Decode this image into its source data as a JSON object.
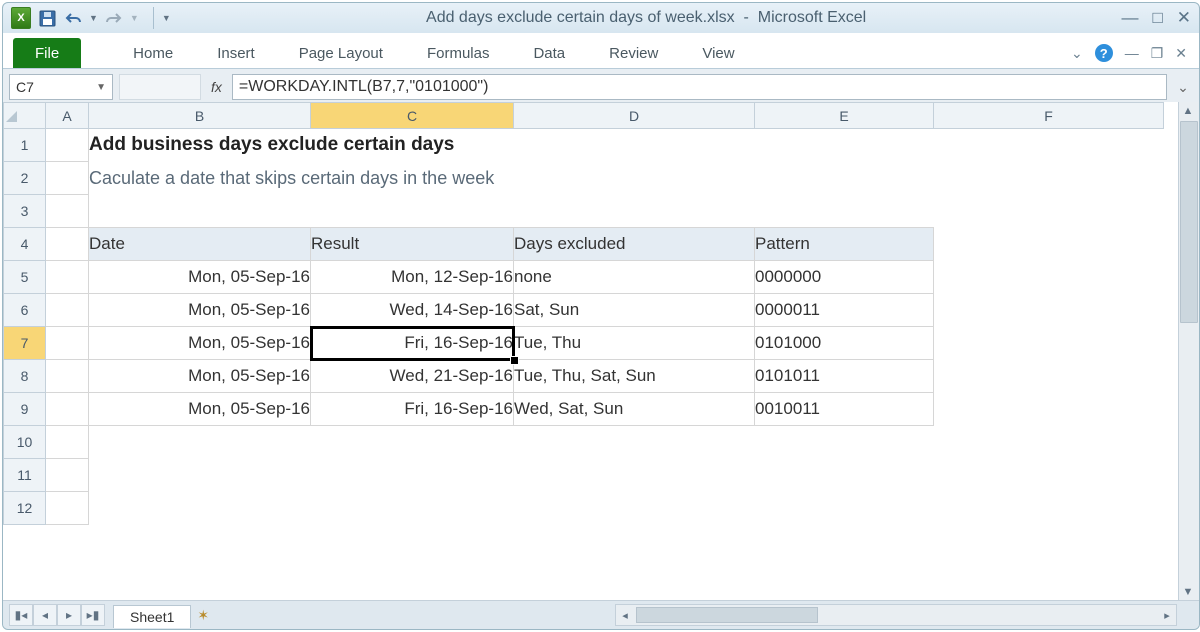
{
  "titlebar": {
    "doc": "Add days exclude certain days of week.xlsx",
    "app": "Microsoft Excel"
  },
  "ribbon": {
    "file": "File",
    "tabs": [
      "Home",
      "Insert",
      "Page Layout",
      "Formulas",
      "Data",
      "Review",
      "View"
    ]
  },
  "formula_bar": {
    "name_box": "C7",
    "fx": "fx",
    "formula": "=WORKDAY.INTL(B7,7,\"0101000\")"
  },
  "columns": [
    "A",
    "B",
    "C",
    "D",
    "E",
    "F"
  ],
  "rows": [
    "1",
    "2",
    "3",
    "4",
    "5",
    "6",
    "7",
    "8",
    "9",
    "10",
    "11",
    "12"
  ],
  "content": {
    "title": "Add business days exclude certain days",
    "subtitle": "Caculate a date that skips certain days in the week",
    "headers": {
      "date": "Date",
      "result": "Result",
      "excluded": "Days excluded",
      "pattern": "Pattern"
    },
    "data": [
      {
        "date": "Mon, 05-Sep-16",
        "result": "Mon, 12-Sep-16",
        "excluded": "none",
        "pattern": "0000000"
      },
      {
        "date": "Mon, 05-Sep-16",
        "result": "Wed, 14-Sep-16",
        "excluded": "Sat, Sun",
        "pattern": "0000011"
      },
      {
        "date": "Mon, 05-Sep-16",
        "result": "Fri, 16-Sep-16",
        "excluded": "Tue, Thu",
        "pattern": "0101000"
      },
      {
        "date": "Mon, 05-Sep-16",
        "result": "Wed, 21-Sep-16",
        "excluded": "Tue, Thu, Sat, Sun",
        "pattern": "0101011"
      },
      {
        "date": "Mon, 05-Sep-16",
        "result": "Fri, 16-Sep-16",
        "excluded": "Wed, Sat, Sun",
        "pattern": "0010011"
      }
    ]
  },
  "sheet_tab": "Sheet1"
}
